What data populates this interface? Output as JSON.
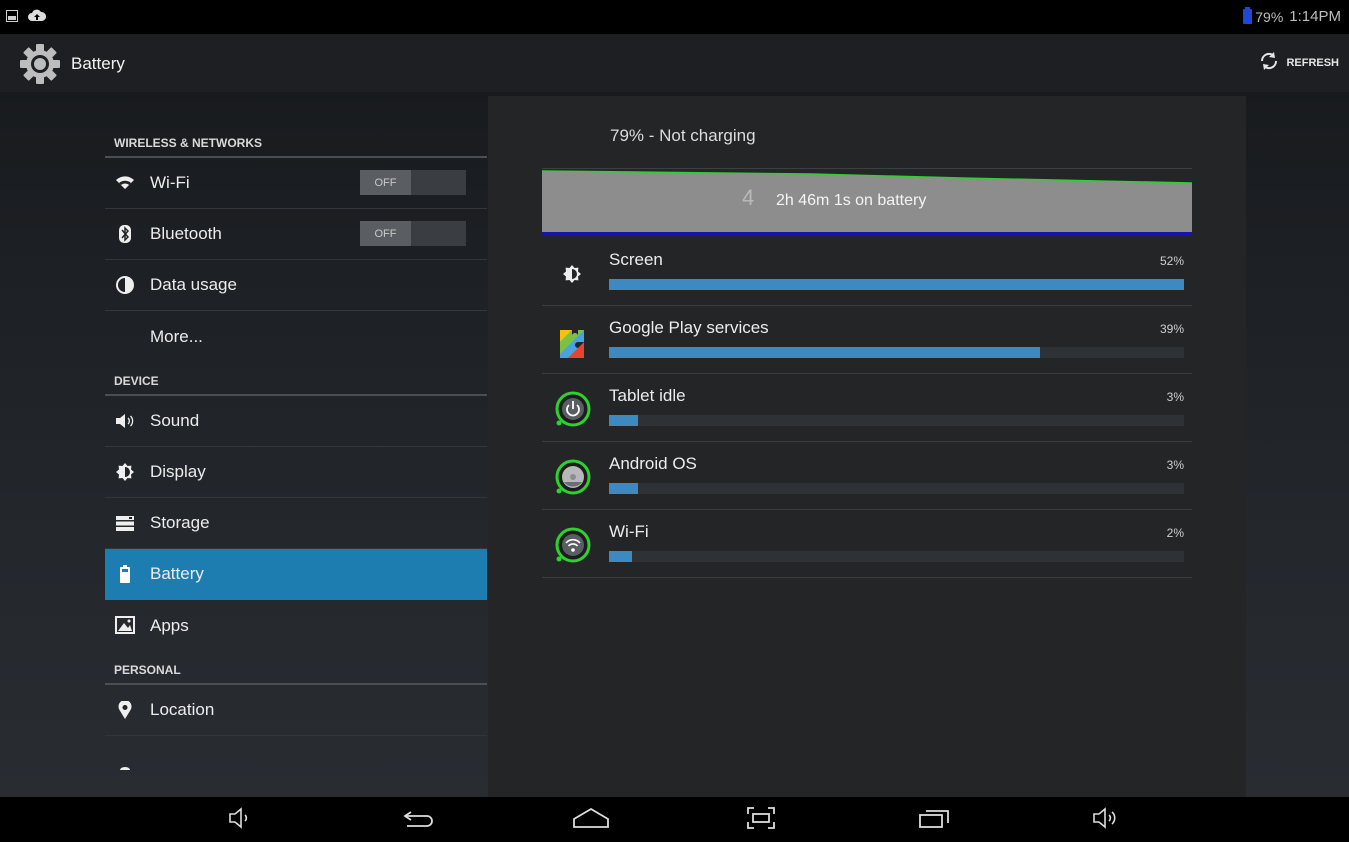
{
  "status_bar": {
    "battery_percent": "79%",
    "time": "1:14PM",
    "left_icons": [
      "picture-icon",
      "cloud-upload-icon"
    ],
    "battery_color": "#1e47d6"
  },
  "action_bar": {
    "title": "Battery",
    "refresh_label": "REFRESH"
  },
  "settings": {
    "sections": [
      {
        "title": "WIRELESS & NETWORKS"
      },
      {
        "title": "DEVICE"
      },
      {
        "title": "PERSONAL"
      }
    ],
    "items": [
      {
        "label": "Wi-Fi",
        "icon": "wifi-icon",
        "toggle": "OFF"
      },
      {
        "label": "Bluetooth",
        "icon": "bluetooth-icon",
        "toggle": "OFF"
      },
      {
        "label": "Data usage",
        "icon": "data-usage-icon"
      },
      {
        "label": "More..."
      },
      {
        "label": "Sound",
        "icon": "speaker-icon"
      },
      {
        "label": "Display",
        "icon": "brightness-icon"
      },
      {
        "label": "Storage",
        "icon": "storage-icon"
      },
      {
        "label": "Battery",
        "icon": "battery-icon",
        "selected": true
      },
      {
        "label": "Apps",
        "icon": "apps-icon"
      },
      {
        "label": "Location",
        "icon": "location-icon"
      }
    ],
    "accent_color": "#1e7db0"
  },
  "battery": {
    "charge_status": "79% - Not charging",
    "graph": {
      "label_num": "4",
      "time_on_battery": "2h 46m 1s on battery",
      "line_color": "#2fd02f"
    },
    "usage": [
      {
        "name": "Screen",
        "percent": "52%",
        "fill": 1.0,
        "icon": "brightness-icon"
      },
      {
        "name": "Google Play services",
        "percent": "39%",
        "fill": 0.75,
        "icon": "google-play-services-icon"
      },
      {
        "name": "Tablet idle",
        "percent": "3%",
        "fill": 0.05,
        "icon": "power-icon"
      },
      {
        "name": "Android OS",
        "percent": "3%",
        "fill": 0.05,
        "icon": "android-os-icon"
      },
      {
        "name": "Wi-Fi",
        "percent": "2%",
        "fill": 0.04,
        "icon": "wifi-icon"
      }
    ],
    "bar_color": "#3d8ac2"
  },
  "nav_bar": {
    "buttons": [
      "volume-down-icon",
      "back-icon",
      "home-icon",
      "screenshot-icon",
      "recent-apps-icon",
      "volume-up-icon"
    ]
  }
}
